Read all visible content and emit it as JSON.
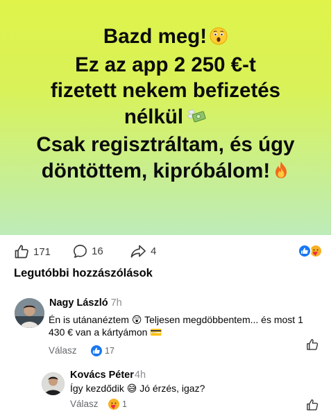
{
  "post": {
    "lines": [
      "Bazd meg!",
      "Ez az app 2 250 €-t",
      "fizetett nekem befizetés",
      "nélkül",
      "Csak regisztráltam, és úgy",
      "döntöttem, kipróbálom!"
    ],
    "emojis": [
      "astonished-face-emoji",
      "money-with-wings-emoji",
      "fire-emoji"
    ]
  },
  "reactions_bar": {
    "likes": "171",
    "comments": "16",
    "shares": "4",
    "badges": [
      "like",
      "care"
    ],
    "colors": {
      "like": "#1877f2",
      "care": "#f7b125"
    }
  },
  "comments_section": {
    "title": "Legutóbbi hozzászólások",
    "comments": [
      {
        "author": "Nagy László",
        "time": "7h",
        "text": "Én is utánanéztem 😲 Teljesen megdöbbentem... és most 1 430 € van a kártyámon 💳",
        "reply_label": "Válasz",
        "reaction_count": "17",
        "reaction_type": "like"
      },
      {
        "author": "Kovács Péter",
        "time": "4h",
        "text": "Így kezdődik 😅 Jó érzés, igaz?",
        "reply_label": "Válasz",
        "reaction_count": "1",
        "reaction_type": "care"
      }
    ]
  }
}
